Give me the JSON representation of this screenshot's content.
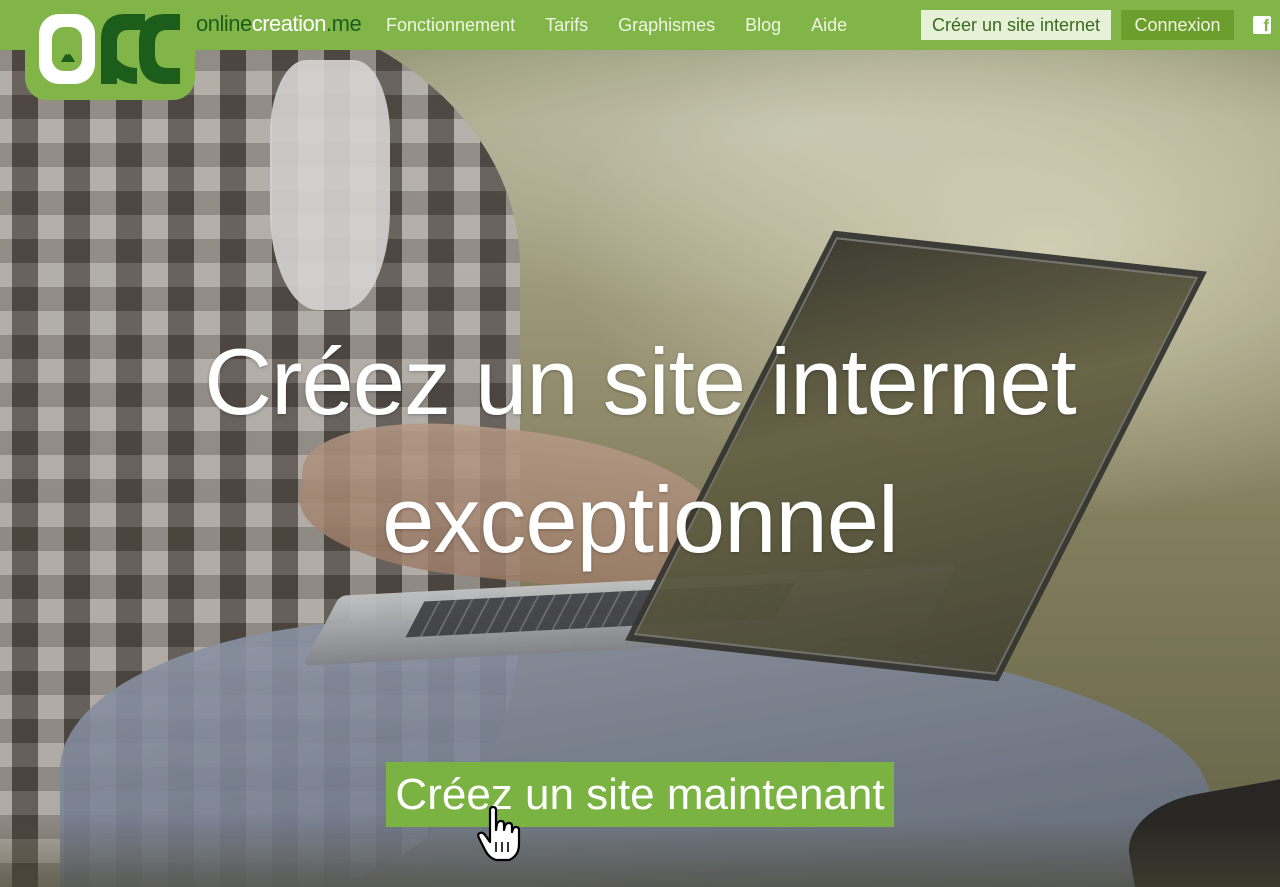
{
  "brand": {
    "logo_alt": "ORC",
    "name_part1": "online",
    "name_part2": "creation",
    "name_part3": ".me"
  },
  "nav": {
    "items": [
      {
        "label": "Fonctionnement"
      },
      {
        "label": "Tarifs"
      },
      {
        "label": "Graphismes"
      },
      {
        "label": "Blog"
      },
      {
        "label": "Aide"
      }
    ],
    "create_button": "Créer un site internet",
    "login_button": "Connexion",
    "social_icon": "facebook-icon"
  },
  "hero": {
    "headline_line1": "Créez un site internet",
    "headline_line2": "exceptionnel",
    "cta_label": "Créez un site maintenant",
    "cursor_icon": "hand-pointer-icon"
  },
  "colors": {
    "brand_green": "#82b548",
    "dark_green": "#1d5d1b",
    "cta_green": "#7ab342"
  }
}
